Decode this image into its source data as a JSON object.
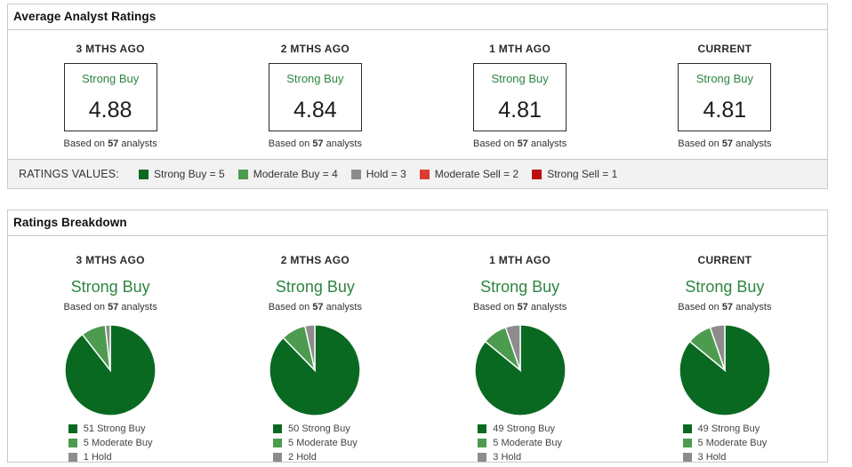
{
  "colors": {
    "strong_buy": "#0a6921",
    "moderate_buy": "#4d9b4f",
    "hold": "#8c8c8c",
    "moderate_sell": "#dd3b34",
    "strong_sell": "#bb0f0f",
    "green_text": "#2e8540"
  },
  "average": {
    "title": "Average Analyst Ratings",
    "based_on": "Based on",
    "analysts_word": "analysts",
    "columns": [
      {
        "period": "3 MTHS AGO",
        "rating": "Strong Buy",
        "value": "4.88",
        "analysts": "57"
      },
      {
        "period": "2 MTHS AGO",
        "rating": "Strong Buy",
        "value": "4.84",
        "analysts": "57"
      },
      {
        "period": "1 MTH AGO",
        "rating": "Strong Buy",
        "value": "4.81",
        "analysts": "57"
      },
      {
        "period": "CURRENT",
        "rating": "Strong Buy",
        "value": "4.81",
        "analysts": "57"
      }
    ]
  },
  "ratings_values": {
    "label": "RATINGS VALUES:",
    "items": [
      {
        "label": "Strong Buy = 5",
        "color_key": "strong_buy"
      },
      {
        "label": "Moderate Buy = 4",
        "color_key": "moderate_buy"
      },
      {
        "label": "Hold = 3",
        "color_key": "hold"
      },
      {
        "label": "Moderate Sell = 2",
        "color_key": "moderate_sell"
      },
      {
        "label": "Strong Sell = 1",
        "color_key": "strong_sell"
      }
    ]
  },
  "breakdown": {
    "title": "Ratings Breakdown",
    "based_on": "Based on",
    "analysts_word": "analysts"
  },
  "chart_data": [
    {
      "type": "pie",
      "period": "3 MTHS AGO",
      "rating": "Strong Buy",
      "analysts": "57",
      "total": 57,
      "slices": [
        {
          "label": "51 Strong Buy",
          "value": 51,
          "color_key": "strong_buy"
        },
        {
          "label": "5 Moderate Buy",
          "value": 5,
          "color_key": "moderate_buy"
        },
        {
          "label": "1 Hold",
          "value": 1,
          "color_key": "hold"
        }
      ]
    },
    {
      "type": "pie",
      "period": "2 MTHS AGO",
      "rating": "Strong Buy",
      "analysts": "57",
      "total": 57,
      "slices": [
        {
          "label": "50 Strong Buy",
          "value": 50,
          "color_key": "strong_buy"
        },
        {
          "label": "5 Moderate Buy",
          "value": 5,
          "color_key": "moderate_buy"
        },
        {
          "label": "2 Hold",
          "value": 2,
          "color_key": "hold"
        }
      ]
    },
    {
      "type": "pie",
      "period": "1 MTH AGO",
      "rating": "Strong Buy",
      "analysts": "57",
      "total": 57,
      "slices": [
        {
          "label": "49 Strong Buy",
          "value": 49,
          "color_key": "strong_buy"
        },
        {
          "label": "5 Moderate Buy",
          "value": 5,
          "color_key": "moderate_buy"
        },
        {
          "label": "3 Hold",
          "value": 3,
          "color_key": "hold"
        }
      ]
    },
    {
      "type": "pie",
      "period": "CURRENT",
      "rating": "Strong Buy",
      "analysts": "57",
      "total": 57,
      "slices": [
        {
          "label": "49 Strong Buy",
          "value": 49,
          "color_key": "strong_buy"
        },
        {
          "label": "5 Moderate Buy",
          "value": 5,
          "color_key": "moderate_buy"
        },
        {
          "label": "3 Hold",
          "value": 3,
          "color_key": "hold"
        }
      ]
    }
  ]
}
